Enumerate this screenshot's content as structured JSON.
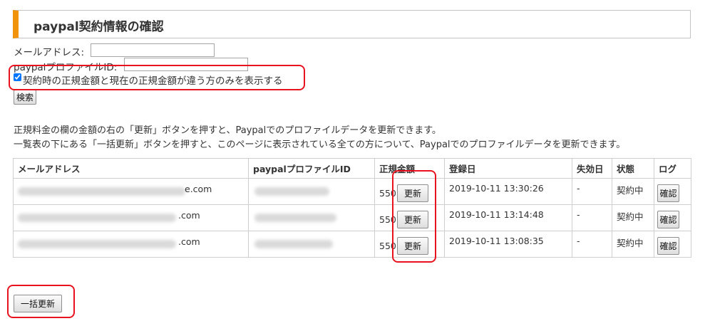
{
  "page": {
    "title": "paypal契約情報の確認"
  },
  "search": {
    "email_label": "メールアドレス:",
    "email_value": "",
    "profile_label": "paypalプロファイルID:",
    "profile_value": "",
    "diff_only_checked": true,
    "diff_only_label": "契約時の正規金額と現在の正規金額が違う方のみを表示する",
    "search_button": "検索"
  },
  "description": {
    "line1": "正規料金の欄の金額の右の「更新」ボタンを押すと、Paypalでのプロファイルデータを更新できます。",
    "line2": "一覧表の下にある「一括更新」ボタンを押すと、このページに表示されている全ての方について、Paypalでのプロファイルデータを更新できます。"
  },
  "table": {
    "headers": {
      "email": "メールアドレス",
      "profile_id": "paypalプロファイルID",
      "price": "正規金額",
      "registered": "登録日",
      "expired": "失効日",
      "status": "状態",
      "log": "ログ"
    },
    "rows": [
      {
        "email_suffix": "e.com",
        "price": "550",
        "update_button": "更新",
        "registered": "2019-10-11 13:30:26",
        "expired": "-",
        "status": "契約中",
        "log_button": "確認"
      },
      {
        "email_suffix": ".com",
        "price": "550",
        "update_button": "更新",
        "registered": "2019-10-11 13:14:48",
        "expired": "-",
        "status": "契約中",
        "log_button": "確認"
      },
      {
        "email_suffix": ".com",
        "price": "550",
        "update_button": "更新",
        "registered": "2019-10-11 13:08:35",
        "expired": "-",
        "status": "契約中",
        "log_button": "確認"
      }
    ]
  },
  "bulk_update_button": "一括更新",
  "colors": {
    "accent": "#f2930c",
    "highlight": "#e8131f"
  }
}
